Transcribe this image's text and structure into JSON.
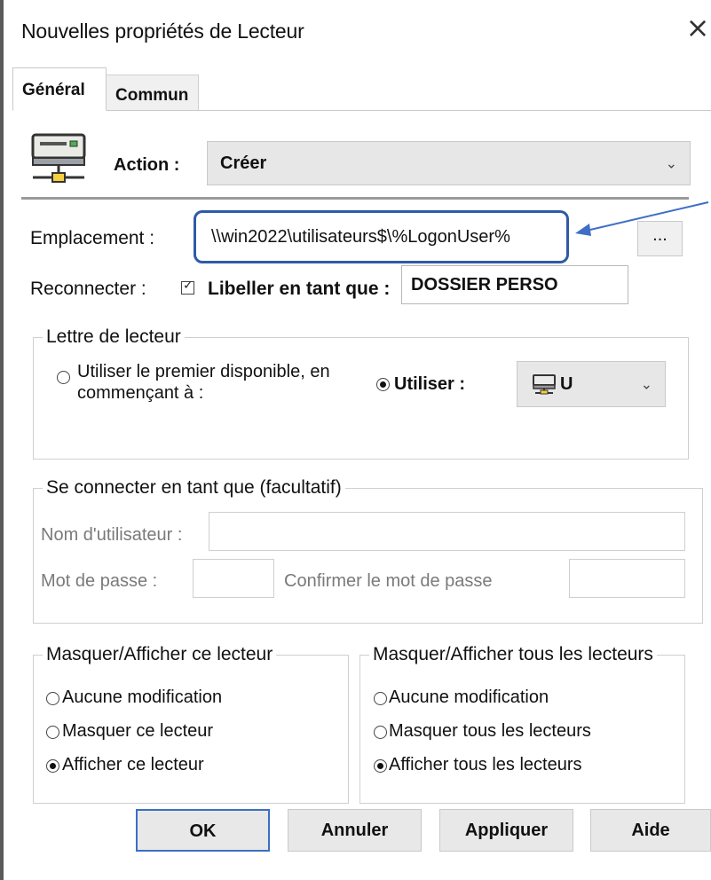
{
  "dialog": {
    "title": "Nouvelles propriétés de Lecteur",
    "close_symbol": "×"
  },
  "tabs": [
    {
      "label": "Général",
      "selected": true
    },
    {
      "label": "Commun",
      "selected": false
    }
  ],
  "icons": {
    "drive": "network-drive-icon",
    "browse": "ellipsis-icon",
    "drive_letter": "drive-icon"
  },
  "action": {
    "label": "Action :",
    "value": "Créer"
  },
  "location": {
    "label": "Emplacement :",
    "value": "\\\\win2022\\utilisateurs$\\%LogonUser%",
    "browse_label": "...",
    "highlight_color": "#2f5aa8"
  },
  "reconnect": {
    "label": "Reconnecter :",
    "checked": true,
    "label_as": "Libeller en tant que :",
    "label_value": "DOSSIER PERSO"
  },
  "drive_letter": {
    "legend": "Lettre de lecteur",
    "option_first_line1": "Utiliser le premier disponible, en",
    "option_first_line2": "commençant à :",
    "option_use": "Utiliser :",
    "selected_letter": "U"
  },
  "connect_as": {
    "legend": "Se connecter en tant que (facultatif)",
    "username_label": "Nom d'utilisateur :",
    "password_label": "Mot de passe :",
    "confirm_label": "Confirmer le mot de passe"
  },
  "hide_show_drive": {
    "legend": "Masquer/Afficher ce lecteur",
    "options": [
      "Aucune modification",
      "Masquer ce lecteur",
      "Afficher ce lecteur"
    ],
    "selected": 2
  },
  "hide_show_all": {
    "legend": "Masquer/Afficher tous les lecteurs",
    "options": [
      "Aucune modification",
      "Masquer tous les lecteurs",
      "Afficher tous les lecteurs"
    ],
    "selected": 2
  },
  "buttons": {
    "ok": "OK",
    "cancel": "Annuler",
    "apply": "Appliquer",
    "help": "Aide"
  },
  "colors": {
    "accent": "#3a6fc4",
    "annotation": "#2f5aa8"
  }
}
